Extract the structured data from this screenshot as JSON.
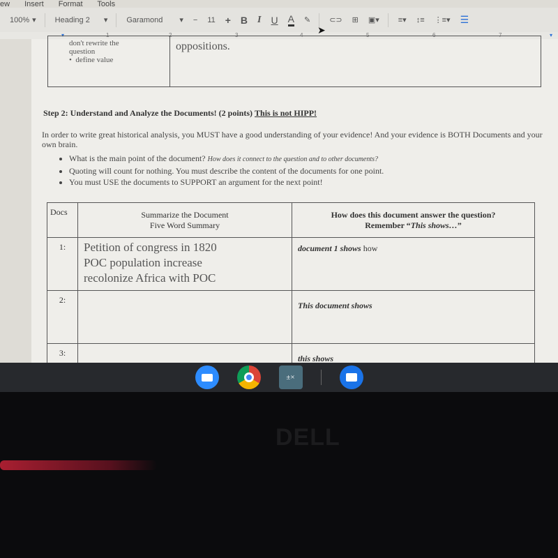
{
  "menu": [
    "ew",
    "Insert",
    "Format",
    "Tools"
  ],
  "toolbar": {
    "zoom": "100%",
    "style": "Heading 2",
    "font": "Garamond",
    "size": "11",
    "minus": "−",
    "plus": "+",
    "bold": "B",
    "italic": "I",
    "underline": "U",
    "color": "A"
  },
  "ruler": [
    "1",
    "2",
    "3",
    "4",
    "5",
    "6",
    "7"
  ],
  "top_table": {
    "left_lines": [
      "don't rewrite the",
      "question"
    ],
    "bullet": "define value",
    "right": "oppositions."
  },
  "step": {
    "title": "Step 2:  Understand and Analyze the Documents! (2 points)",
    "underlined": "This is not HIPP!"
  },
  "intro": "In order to write great historical analysis, you MUST have a good understanding of your evidence! And your evidence is BOTH Documents and your own brain.",
  "bullets": [
    {
      "text": "What is the main point of the document? ",
      "italic": "How does it connect to the question and to other documents?"
    },
    {
      "text": "Quoting will count for nothing. You must describe the content of the documents for one point.",
      "italic": ""
    },
    {
      "text": "You must USE the documents to SUPPORT an argument for the next point!",
      "italic": ""
    }
  ],
  "doc_table": {
    "headers": [
      "Docs",
      "Summarize the Document",
      "Five Word Summary",
      "How does this document answer the question?",
      "Remember “",
      "This shows…",
      "”"
    ],
    "rows": [
      {
        "num": "1:",
        "summary": [
          "Petition of congress in 1820",
          "POC population increase",
          "recolonize Africa with POC"
        ],
        "answer_italic": "document 1 shows",
        "answer": " how"
      },
      {
        "num": "2:",
        "summary": [],
        "answer_italic": "This document  shows",
        "answer": ""
      },
      {
        "num": "3:",
        "summary": [],
        "answer_italic": "this shows",
        "answer": ""
      }
    ]
  },
  "taskbar": [
    "zoom-app",
    "chrome",
    "calculator",
    "files"
  ],
  "brand": "DELL"
}
